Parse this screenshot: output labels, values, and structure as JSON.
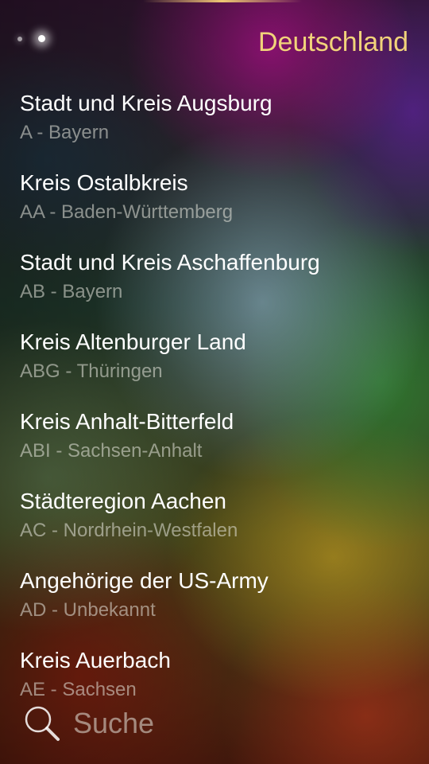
{
  "header": {
    "title": "Deutschland",
    "page_indicator": {
      "count": 2,
      "active_index": 1
    }
  },
  "items": [
    {
      "title": "Stadt und Kreis Augsburg",
      "subtitle": "A - Bayern"
    },
    {
      "title": "Kreis Ostalbkreis",
      "subtitle": "AA - Baden-Württemberg"
    },
    {
      "title": "Stadt und Kreis Aschaffenburg",
      "subtitle": "AB - Bayern"
    },
    {
      "title": "Kreis Altenburger Land",
      "subtitle": "ABG - Thüringen"
    },
    {
      "title": "Kreis Anhalt-Bitterfeld",
      "subtitle": "ABI - Sachsen-Anhalt"
    },
    {
      "title": "Städteregion Aachen",
      "subtitle": "AC - Nordrhein-Westfalen"
    },
    {
      "title": "Angehörige der US-Army",
      "subtitle": "AD - Unbekannt"
    },
    {
      "title": "Kreis Auerbach",
      "subtitle": "AE - Sachsen"
    }
  ],
  "search": {
    "label": "Suche",
    "icon": "search-icon"
  },
  "colors": {
    "title_accent": "#f1d37a",
    "primary_text": "#ffffff",
    "secondary_text": "#e6e6dc"
  }
}
